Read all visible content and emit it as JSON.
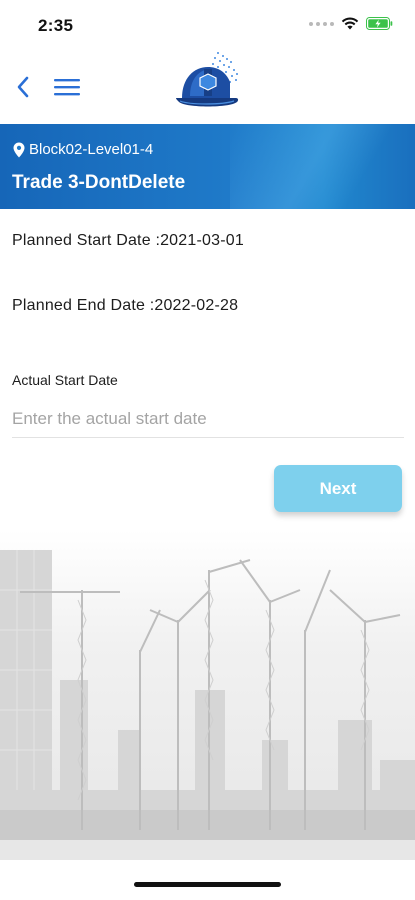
{
  "status_bar": {
    "time": "2:35"
  },
  "header": {
    "location": "Block02-Level01-4",
    "trade_title": "Trade 3-DontDelete"
  },
  "details": {
    "planned_start": "Planned Start Date :2021-03-01",
    "planned_end": "Planned End Date :2022-02-28"
  },
  "form": {
    "actual_start_label": "Actual Start Date",
    "actual_start_placeholder": "Enter the actual start date",
    "actual_start_value": ""
  },
  "actions": {
    "next_label": "Next"
  },
  "colors": {
    "header_blue": "#1f7ac9",
    "next_button": "#7ed0ed",
    "nav_icon_blue": "#2a6fd6"
  },
  "icons": [
    "back-chevron-icon",
    "hamburger-menu-icon",
    "hard-hat-logo",
    "location-pin-icon",
    "wifi-icon",
    "battery-icon"
  ]
}
